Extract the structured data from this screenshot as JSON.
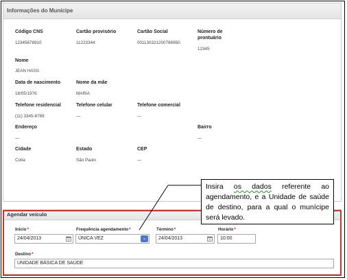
{
  "municipe_panel": {
    "title": "Informações do Munícipe",
    "fields": {
      "cns": {
        "label": "Código CNS",
        "value": "12345678910"
      },
      "cartao_provisorio": {
        "label": "Cartão provisório",
        "value": "11223344"
      },
      "cartao_social": {
        "label": "Cartão Social",
        "value": "001130321200786950"
      },
      "prontuario": {
        "label_line1": "Número de",
        "label_line2": "prontuário",
        "value": "12345"
      },
      "nome": {
        "label": "Nome",
        "value": "JEAN HASS"
      },
      "nascimento": {
        "label": "Data de nascimento",
        "value": "18/05/1976"
      },
      "mae": {
        "label": "Nome da mãe",
        "value": "MARIA"
      },
      "tel_res": {
        "label": "Telefone residencial",
        "value": "(11) 3345-6789"
      },
      "tel_cel": {
        "label": "Telefone celular",
        "value": "—"
      },
      "tel_com": {
        "label": "Telefone comercial",
        "value": "—"
      },
      "endereco": {
        "label": "Endereço",
        "value": "—"
      },
      "bairro": {
        "label": "Bairro",
        "value": "—"
      },
      "cidade": {
        "label": "Cidade",
        "value": "Cotia"
      },
      "estado": {
        "label": "Estado",
        "value": "São Paulo"
      },
      "cep": {
        "label": "CEP",
        "value": "—"
      }
    }
  },
  "schedule_panel": {
    "title": "Agendar veículo",
    "required_mark": "*",
    "inicio": {
      "label": "Início",
      "value": "24/04/2013"
    },
    "frequencia": {
      "label": "Frequência agendamento",
      "value": "ÚNICA VEZ"
    },
    "termino": {
      "label": "Término",
      "value": "24/04/2013"
    },
    "horario": {
      "label": "Horário",
      "value": "10:00"
    },
    "destino": {
      "label": "Destino",
      "value": "UNIDADE BÁSICA DE SAÚDE"
    }
  },
  "callout": {
    "text_start": "Insira ",
    "text_wavy": "os dados",
    "text_rest": " referente ao agendamento, e a Unidade de saúde de destino, para a qual o munícipe será levado."
  },
  "icons": {
    "calendar": "calendar-icon",
    "dropdown": "chevron-down-icon"
  },
  "colors": {
    "highlight_border": "#c0392b",
    "required": "#d0021b",
    "dropdown_button": "#4a79c9"
  }
}
